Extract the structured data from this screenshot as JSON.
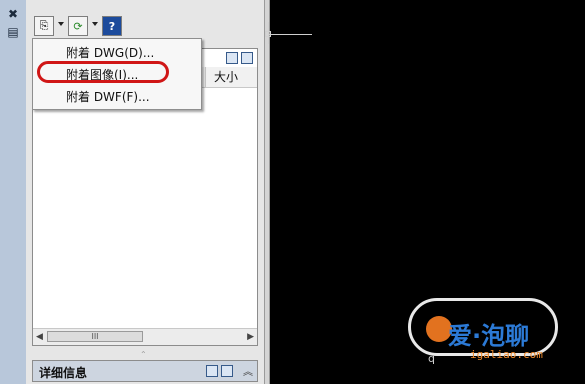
{
  "strip": {
    "icons": [
      "close-icon",
      "properties-icon"
    ]
  },
  "toolbar": {
    "buttons": [
      "attach-icon",
      "refresh-icon",
      "help-icon"
    ],
    "help_glyph": "?"
  },
  "list": {
    "size_column": "大小",
    "scroll_thumb": "III"
  },
  "menu": {
    "items": [
      "附着 DWG(D)...",
      "附着图像(I)...",
      "附着 DWF(F)..."
    ],
    "highlighted_index": 1,
    "highlight_color": "#d01616"
  },
  "details": {
    "label": "详细信息"
  },
  "watermark": {
    "text": "爱·泡聊",
    "sub": "q",
    "url": "igaliao.com"
  }
}
